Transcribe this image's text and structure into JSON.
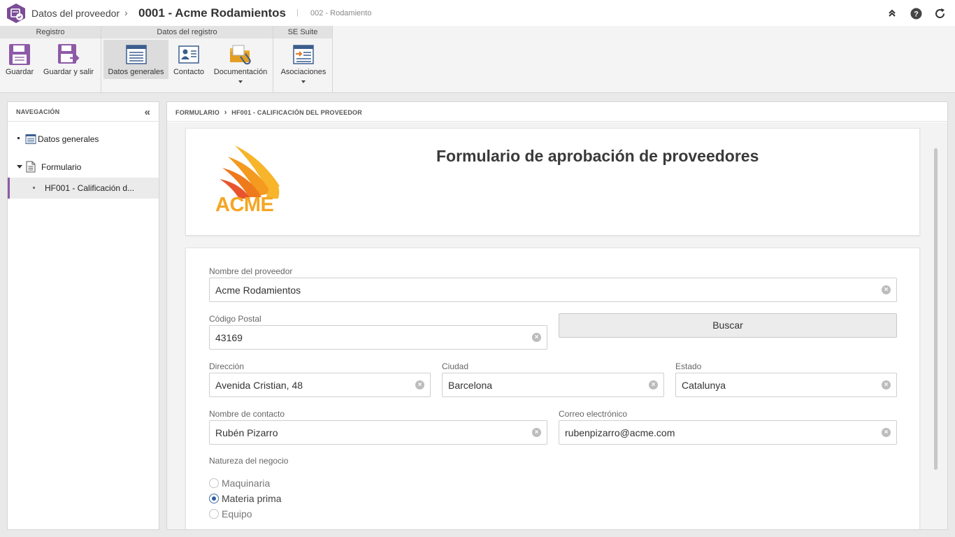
{
  "titlebar": {
    "parent": "Datos del proveedor",
    "separator": "›",
    "title": "0001 - Acme Rodamientos",
    "pipe": "|",
    "subtitle": "002 - Rodamiento"
  },
  "ribbon": {
    "groups": [
      {
        "title": "Registro"
      },
      {
        "title": "Datos del registro"
      },
      {
        "title": "SE Suite"
      }
    ],
    "buttons": {
      "guardar": "Guardar",
      "guardar_salir": "Guardar y salir",
      "datos_generales": "Datos generales",
      "contacto": "Contacto",
      "documentacion": "Documentación",
      "asociaciones": "Asociaciones"
    }
  },
  "nav": {
    "heading": "NAVEGACIÓN",
    "items": [
      {
        "label": "Datos generales"
      },
      {
        "label": "Formulario"
      },
      {
        "label": "HF001 - Calificación d..."
      }
    ]
  },
  "main": {
    "breadcrumb": [
      "FORMULARIO",
      "HF001 - CALIFICACIÓN DEL PROVEEDOR"
    ],
    "form_title": "Formulario de aprobación de proveedores",
    "logo_text": "ACME",
    "fields": {
      "nombre_proveedor": {
        "label": "Nombre del proveedor",
        "value": "Acme Rodamientos"
      },
      "codigo_postal": {
        "label": "Código Postal",
        "value": "43169"
      },
      "direccion": {
        "label": "Dirección",
        "value": "Avenida Cristian, 48"
      },
      "ciudad": {
        "label": "Ciudad",
        "value": "Barcelona"
      },
      "estado": {
        "label": "Estado",
        "value": "Catalunya"
      },
      "nombre_contacto": {
        "label": "Nombre de contacto",
        "value": "Rubén Pizarro"
      },
      "correo": {
        "label": "Correo electrónico",
        "value": "rubenpizarro@acme.com"
      }
    },
    "buscar_label": "Buscar",
    "naturaleza": {
      "label": "Natureza del negocio",
      "options": [
        "Maquinaria",
        "Materia prima",
        "Equipo"
      ],
      "selected": "Materia prima"
    }
  },
  "colors": {
    "accent": "#8a5aa5",
    "logo_orange": "#f5a623",
    "logo_red": "#e8552d",
    "radio_selected": "#2c5fa3"
  }
}
